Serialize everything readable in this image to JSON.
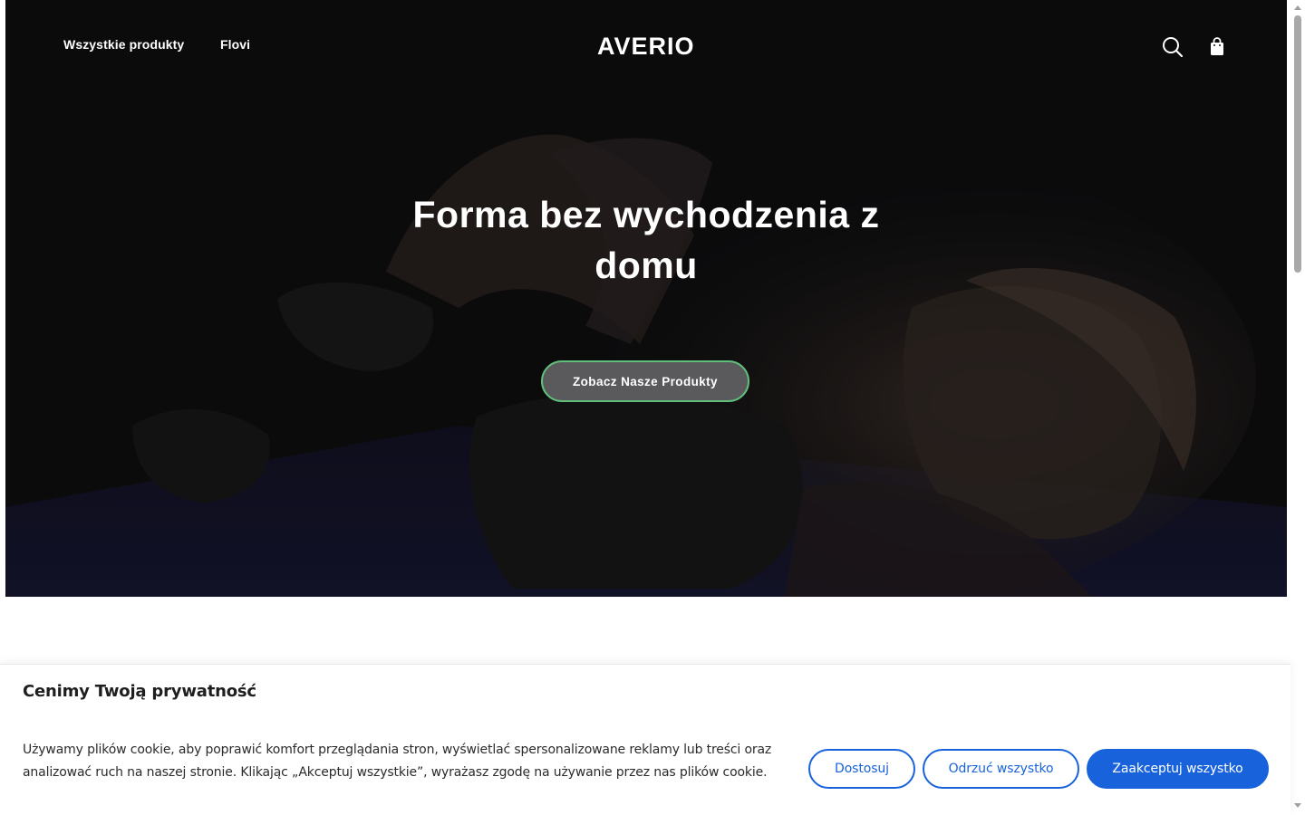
{
  "header": {
    "nav_links": [
      {
        "label": "Wszystkie produkty"
      },
      {
        "label": "Flovi"
      }
    ],
    "logo": "AVERIO",
    "icons": [
      "search-icon",
      "shopping-bag-icon"
    ]
  },
  "hero": {
    "title": "Forma bez wychodzenia z domu",
    "cta_label": "Zobacz Nasze Produkty",
    "cta_border_color": "#5fbf7b"
  },
  "cookie_banner": {
    "title": "Cenimy Twoją prywatność",
    "text": "Używamy plików cookie, aby poprawić komfort przeglądania stron, wyświetlać spersonalizowane reklamy lub treści oraz analizować ruch na naszej stronie. Klikając „Akceptuj wszystkie”, wyrażasz zgodę na używanie przez nas plików cookie.",
    "buttons": {
      "customize": "Dostosuj",
      "reject": "Odrzuć wszystko",
      "accept": "Zaakceptuj wszystko"
    },
    "accent_color": "#1863dc"
  }
}
